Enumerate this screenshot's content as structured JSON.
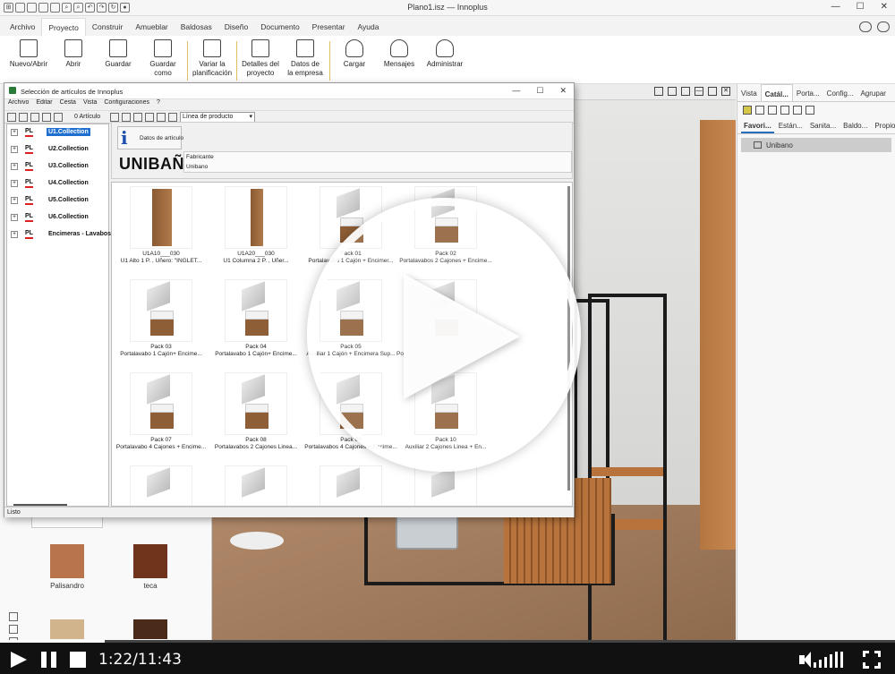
{
  "window": {
    "title": "Plano1.isz — Innoplus"
  },
  "menu": {
    "tabs": [
      "Archivo",
      "Proyecto",
      "Construir",
      "Amueblar",
      "Baldosas",
      "Diseño",
      "Documento",
      "Presentar",
      "Ayuda"
    ],
    "active": "Proyecto"
  },
  "ribbon": {
    "new_open": "Nuevo/Abrir",
    "open": "Abrir",
    "save": "Guardar",
    "save_as_1": "Guardar",
    "save_as_2": "como",
    "vary_1": "Variar la",
    "vary_2": "planificación",
    "details_1": "Detalles del",
    "details_2": "proyecto",
    "company_1": "Datos de",
    "company_2": "la empresa",
    "upload": "Cargar",
    "messages": "Mensajes",
    "admin": "Administrar"
  },
  "dialog": {
    "title": "Selección de artículos de Innoplus",
    "menu": [
      "Archivo",
      "Editar",
      "Cesta",
      "Vista",
      "Configuraciones",
      "?"
    ],
    "article_count": "0 Artículo",
    "line_select": "Línea de producto",
    "tree": [
      {
        "prefix": "PL",
        "label": "U1.Collection",
        "selected": true
      },
      {
        "prefix": "PL",
        "label": "U2.Collection"
      },
      {
        "prefix": "PL",
        "label": "U3.Collection"
      },
      {
        "prefix": "PL",
        "label": "U4.Collection"
      },
      {
        "prefix": "PL",
        "label": "U5.Collection"
      },
      {
        "prefix": "PL",
        "label": "U6.Collection"
      },
      {
        "prefix": "PL",
        "label": "Encimeras - Lavabos - C"
      }
    ],
    "info_button": "Datos de artículo",
    "brand": "UNIBAÑO",
    "maker_label": "Fabricante",
    "maker_value": "Unibano",
    "status": "Listo",
    "items": [
      {
        "code": "U1A10___030",
        "desc": "U1 Alto 1 P. , Uñero: \"INGLET..."
      },
      {
        "code": "U1A20___030",
        "desc": "U1 Columna 2 P. , Uñer..."
      },
      {
        "code": "Pack 01",
        "desc": "Portalavabo 1 Cajón + Encimer..."
      },
      {
        "code": "Pack 02",
        "desc": "Portalavabos 2 Cajones + Encime..."
      },
      {
        "code": "Pack 03",
        "desc": "Portalavabo 1 Cajón+ Encime..."
      },
      {
        "code": "Pack 04",
        "desc": "Portalavabo 1 Cajón+ Encime..."
      },
      {
        "code": "Pack 05",
        "desc": "Auxiliar 1 Cajón + Encimera Sup..."
      },
      {
        "code": "",
        "desc": "Po"
      },
      {
        "code": "Pack 07",
        "desc": "Portalavabo 4 Cajones + Encime..."
      },
      {
        "code": "Pack 08",
        "desc": "Portalavabos 2 Cajones Linea..."
      },
      {
        "code": "Pack 09",
        "desc": "Portalavabos 4 Cajones + Encime..."
      },
      {
        "code": "Pack 10",
        "desc": "Auxiliar 2 Cajones Linea + En..."
      }
    ]
  },
  "left_panel": {
    "swatches": [
      {
        "name": "Palisandro",
        "color": "#b8744a"
      },
      {
        "name": "teca",
        "color": "#6e341c"
      }
    ]
  },
  "right_panel": {
    "tabs": [
      "Vista",
      "Catál...",
      "Porta...",
      "Config...",
      "Agrupar"
    ],
    "active_tab": "Catál...",
    "subtabs": [
      "Favori...",
      "Están...",
      "Sanita...",
      "Baldo...",
      "Propio"
    ],
    "active_subtab": "Favori...",
    "selected": "Unibano"
  },
  "player": {
    "time": "1:22/11:43",
    "progress": 0.117
  },
  "colors": {
    "accent": "#1e6fd0",
    "player_bg": "#111111"
  }
}
